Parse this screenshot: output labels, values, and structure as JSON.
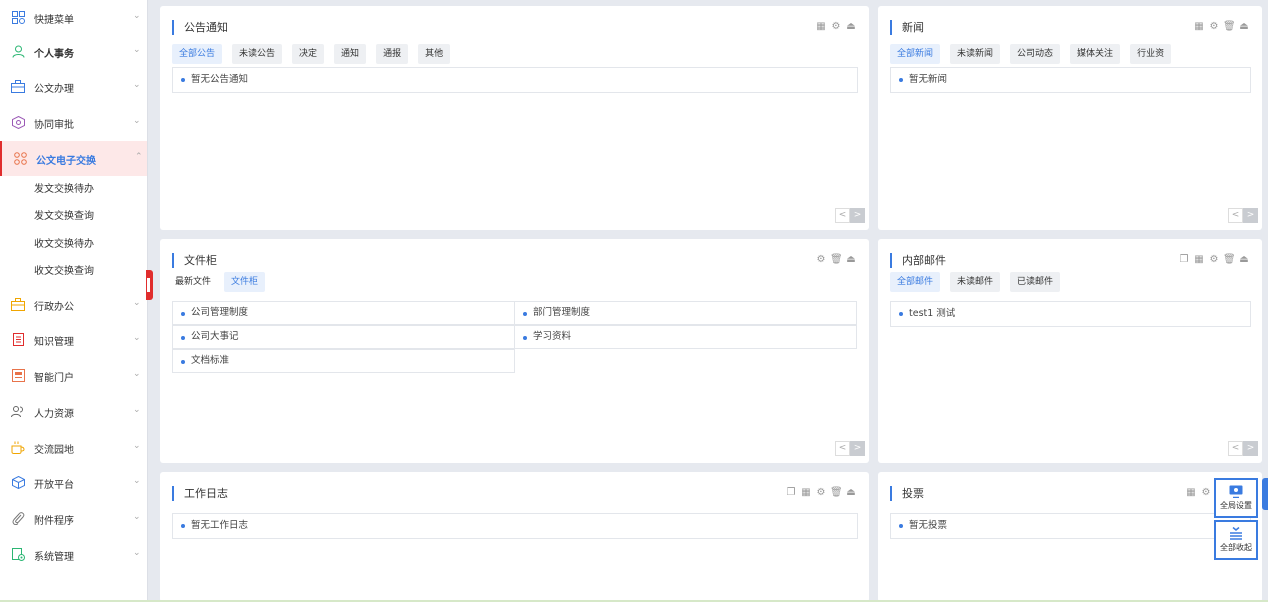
{
  "sidebar": {
    "items": [
      {
        "label": "快捷菜单",
        "icon": "grid-icon"
      },
      {
        "label": "个人事务",
        "icon": "user-icon"
      },
      {
        "label": "公文办理",
        "icon": "briefcase-icon"
      },
      {
        "label": "协同审批",
        "icon": "cube-icon"
      },
      {
        "label": "公文电子交换",
        "icon": "apps-icon"
      },
      {
        "label": "行政办公",
        "icon": "toolbox-icon"
      },
      {
        "label": "知识管理",
        "icon": "book-icon"
      },
      {
        "label": "智能门户",
        "icon": "portal-icon"
      },
      {
        "label": "人力资源",
        "icon": "people-icon"
      },
      {
        "label": "交流园地",
        "icon": "cup-icon"
      },
      {
        "label": "开放平台",
        "icon": "box-icon"
      },
      {
        "label": "附件程序",
        "icon": "paperclip-icon"
      },
      {
        "label": "系统管理",
        "icon": "settings-doc-icon"
      }
    ],
    "subitems": [
      "发文交换待办",
      "发文交换查询",
      "收文交换待办",
      "收文交换查询"
    ],
    "chevron": "⌄",
    "chevron_up": "⌃"
  },
  "panels": {
    "notice": {
      "title": "公告通知",
      "tabs": [
        "全部公告",
        "未读公告",
        "决定",
        "通知",
        "通报",
        "其他"
      ],
      "rows": [
        "暂无公告通知"
      ]
    },
    "news": {
      "title": "新闻",
      "tabs": [
        "全部新闻",
        "未读新闻",
        "公司动态",
        "媒体关注",
        "行业资"
      ],
      "rows": [
        "暂无新闻"
      ]
    },
    "files": {
      "title": "文件柜",
      "tabs": [
        "最新文件",
        "文件柜"
      ],
      "cells": [
        "公司管理制度",
        "部门管理制度",
        "公司大事记",
        "学习资料",
        "文档标准"
      ]
    },
    "mail": {
      "title": "内部邮件",
      "tabs": [
        "全部邮件",
        "未读邮件",
        "已读邮件"
      ],
      "rows": [
        "test1 测试"
      ]
    },
    "diary": {
      "title": "工作日志",
      "rows": [
        "暂无工作日志"
      ]
    },
    "vote": {
      "title": "投票",
      "rows": [
        "暂无投票"
      ]
    }
  },
  "pager": {
    "prev": "<",
    "next": ">"
  },
  "floating": {
    "global_settings": "全局设置",
    "collapse_all": "全部收起"
  },
  "colors": {
    "accent": "#3a7be0",
    "active_bg": "#fde8e8",
    "active_border": "#e02d2d"
  }
}
